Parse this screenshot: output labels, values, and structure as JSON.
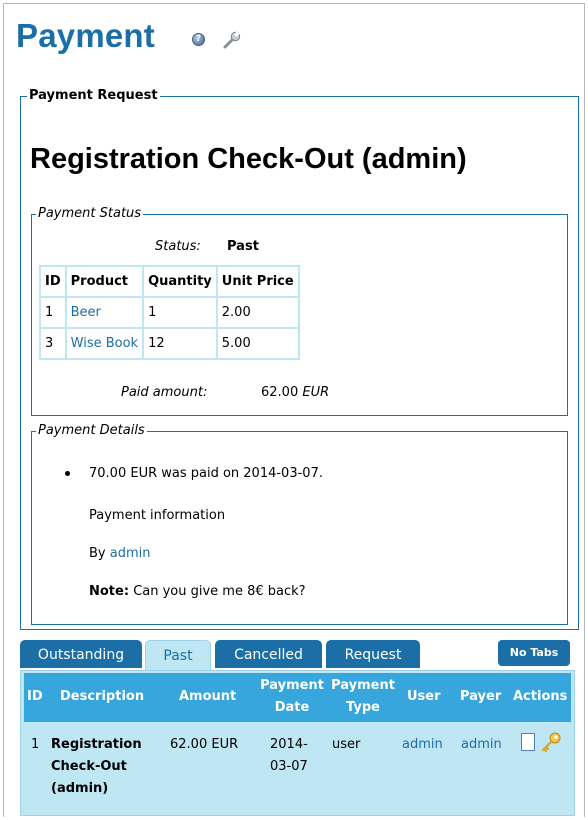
{
  "page": {
    "title": "Payment"
  },
  "payment_request": {
    "legend": "Payment Request",
    "heading": "Registration Check-Out (admin)",
    "status_box": {
      "legend": "Payment Status",
      "status_label": "Status:",
      "status_value": "Past",
      "columns": [
        "ID",
        "Product",
        "Quantity",
        "Unit Price"
      ],
      "rows": [
        {
          "id": "1",
          "product": "Beer",
          "quantity": "1",
          "unit_price": "2.00"
        },
        {
          "id": "3",
          "product": "Wise Book",
          "quantity": "12",
          "unit_price": "5.00"
        }
      ],
      "paid_label": "Paid amount:",
      "paid_value": "62.00",
      "paid_currency": "EUR"
    },
    "details_box": {
      "legend": "Payment Details",
      "bullet": "70.00 EUR was paid on 2014-03-07.",
      "info_label": "Payment information",
      "by_prefix": "By",
      "by_user": "admin",
      "note_label": "Note:",
      "note_text": "Can you give me 8€ back?"
    }
  },
  "tabs": {
    "items": [
      "Outstanding",
      "Past",
      "Cancelled",
      "Request"
    ],
    "active": "Past",
    "no_tabs": "No Tabs"
  },
  "grid": {
    "headers": {
      "id": "ID",
      "description": "Description",
      "amount": "Amount",
      "payment_date_1": "Payment",
      "payment_date_2": "Date",
      "payment_type_1": "Payment",
      "payment_type_2": "Type",
      "user": "User",
      "payer": "Payer",
      "actions": "Actions"
    },
    "row": {
      "id": "1",
      "description_1": "Registration",
      "description_2": "Check-Out",
      "description_3": "(admin)",
      "amount": "62.00 EUR",
      "date_1": "2014-",
      "date_2": "03-07",
      "type": "user",
      "user": "admin",
      "payer": "admin"
    }
  },
  "icons": {
    "help": "help-icon",
    "wrench": "wrench-icon",
    "view": "document-icon",
    "edit": "key-icon"
  },
  "colors": {
    "accent": "#1b6ea6",
    "header_bg": "#36a6dc",
    "row_bg": "#bfe6f3"
  }
}
